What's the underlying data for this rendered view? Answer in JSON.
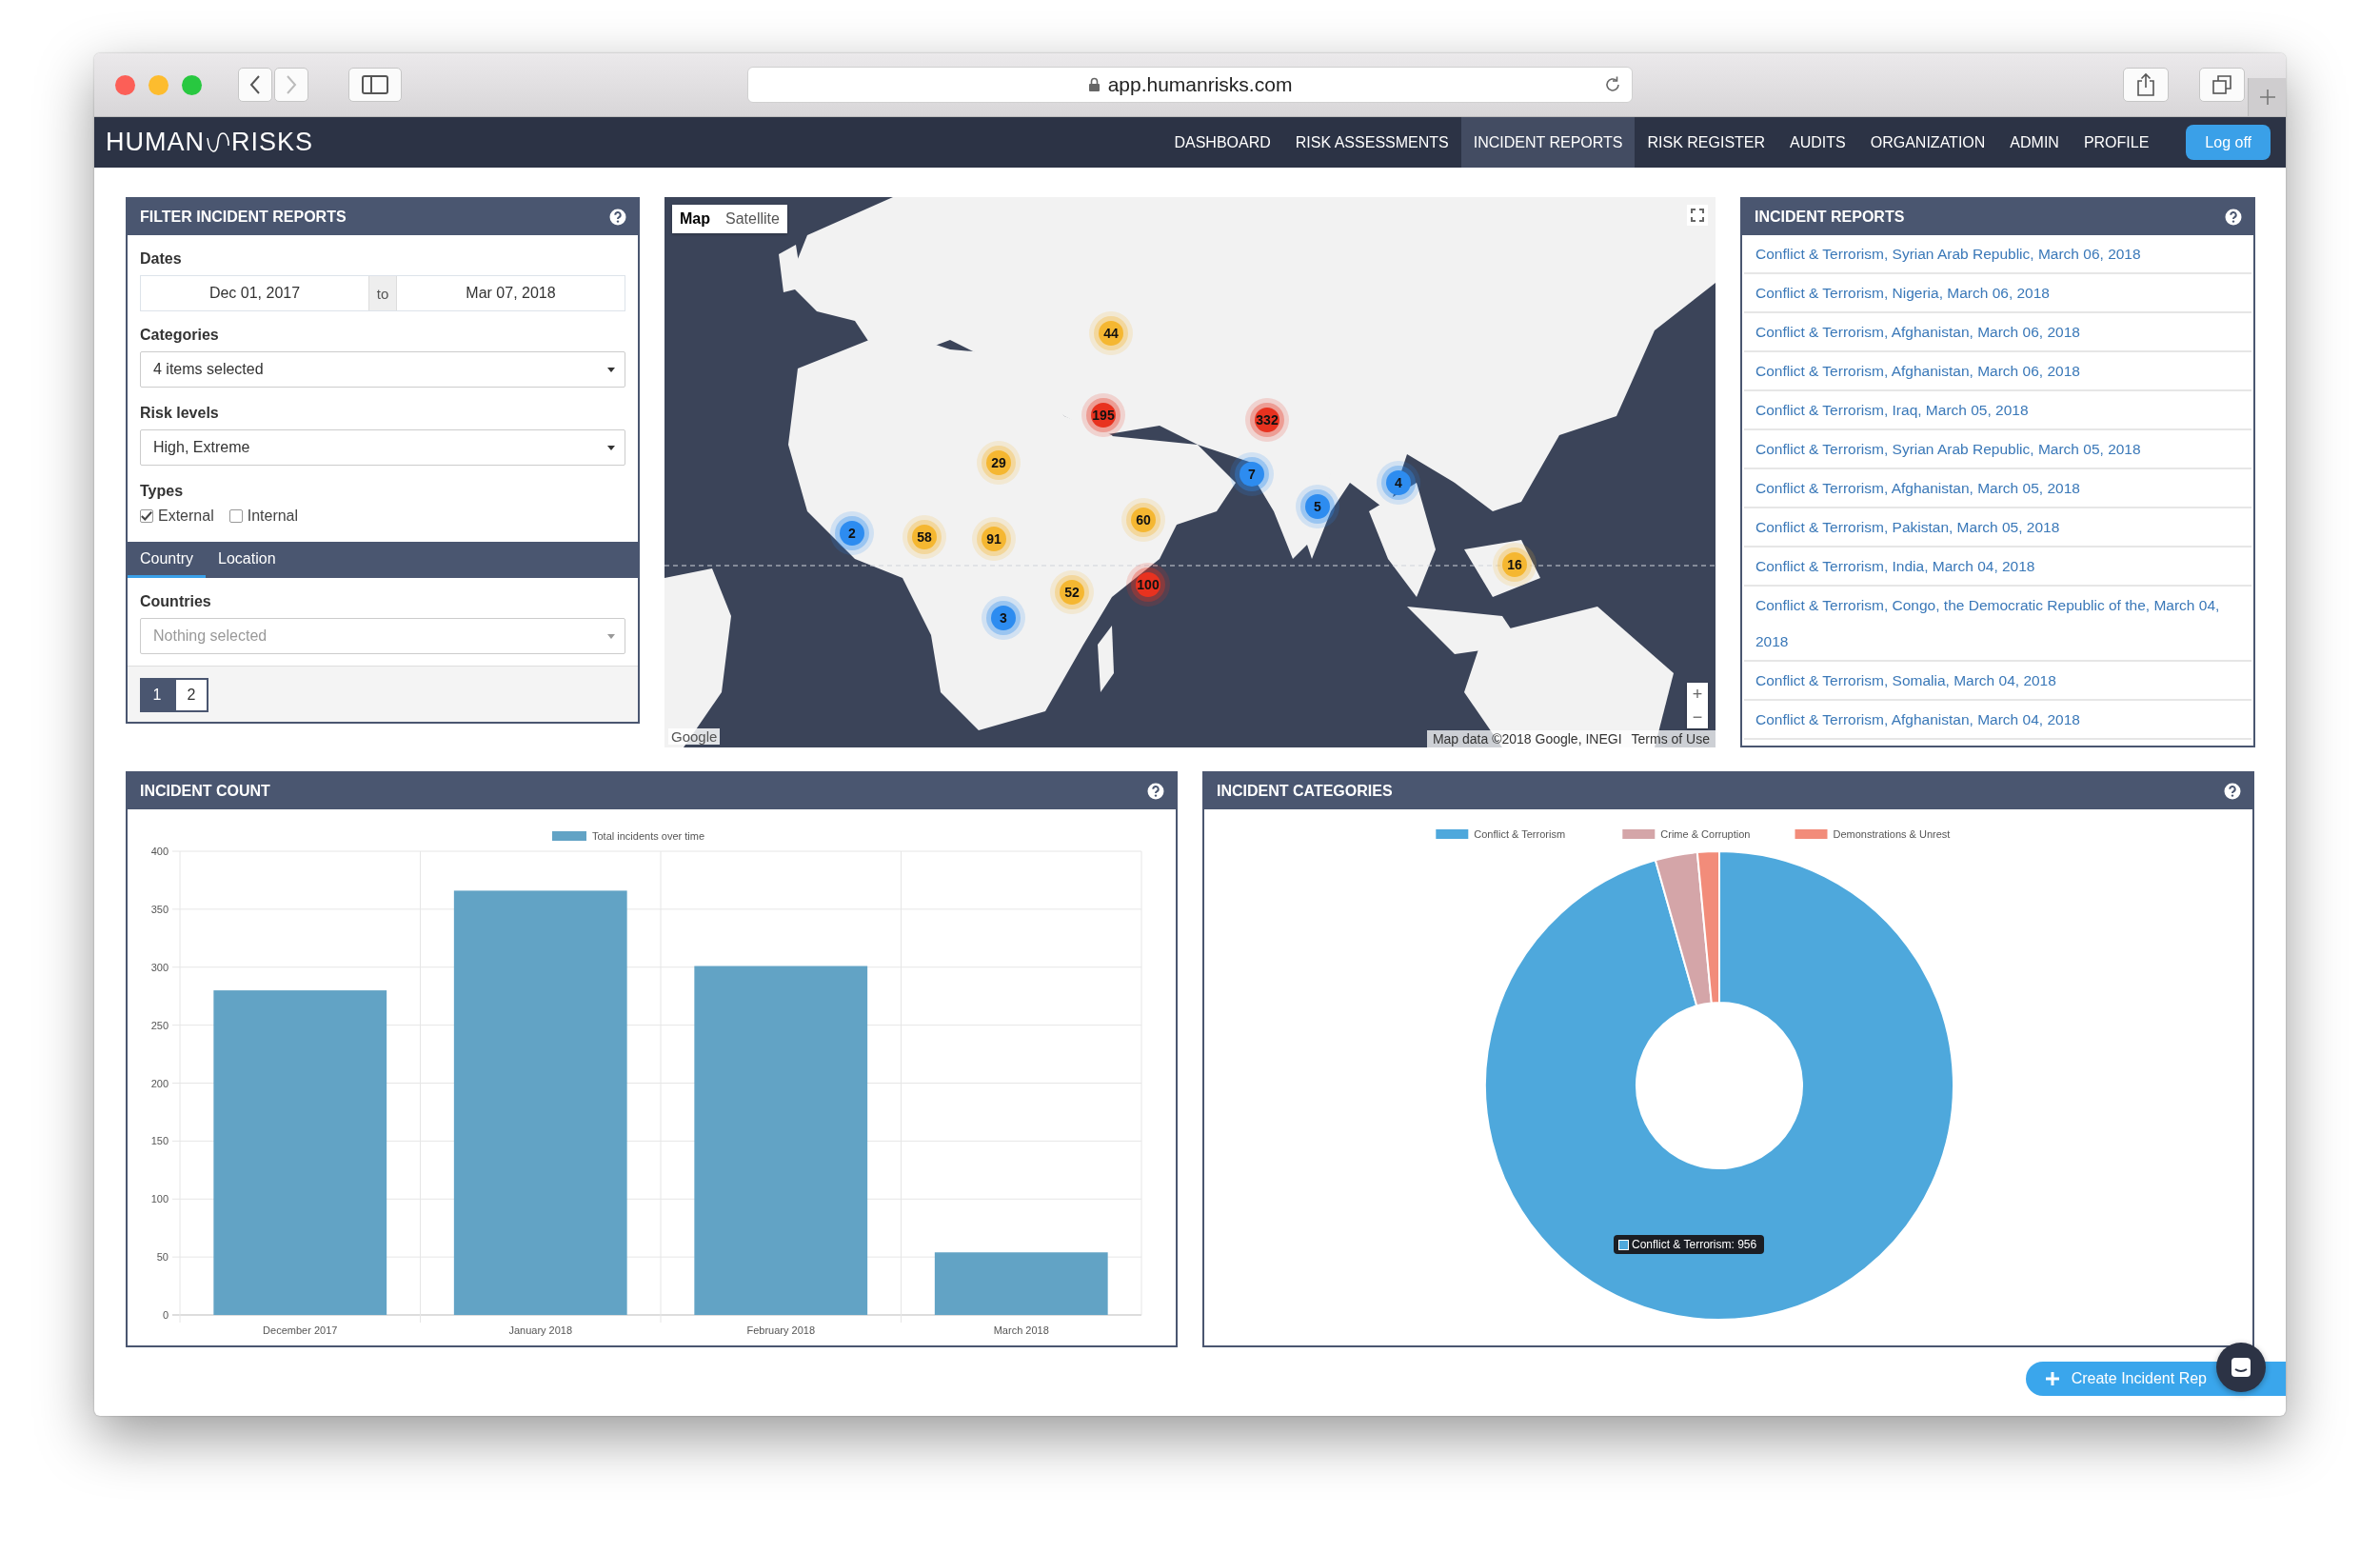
{
  "browser": {
    "url": "app.humanrisks.com"
  },
  "logo": [
    "HUMAN",
    "RISKS"
  ],
  "nav": [
    {
      "label": "DASHBOARD",
      "selected": false
    },
    {
      "label": "RISK ASSESSMENTS",
      "selected": false
    },
    {
      "label": "INCIDENT REPORTS",
      "selected": true
    },
    {
      "label": "RISK REGISTER",
      "selected": false
    },
    {
      "label": "AUDITS",
      "selected": false
    },
    {
      "label": "ORGANIZATION",
      "selected": false
    },
    {
      "label": "ADMIN",
      "selected": false
    },
    {
      "label": "PROFILE",
      "selected": false
    }
  ],
  "logoff": "Log off",
  "filter": {
    "title": "FILTER INCIDENT REPORTS",
    "dates_label": "Dates",
    "date_from": "Dec 01, 2017",
    "date_sep": "to",
    "date_to": "Mar 07, 2018",
    "categories_label": "Categories",
    "categories_value": "4 items selected",
    "risk_label": "Risk levels",
    "risk_value": "High, Extreme",
    "types_label": "Types",
    "types": [
      {
        "label": "External",
        "checked": true
      },
      {
        "label": "Internal",
        "checked": false
      }
    ],
    "tabs": [
      {
        "label": "Country",
        "selected": true
      },
      {
        "label": "Location",
        "selected": false
      }
    ],
    "countries_label": "Countries",
    "countries_placeholder": "Nothing selected",
    "pages": [
      {
        "label": "1",
        "selected": true
      },
      {
        "label": "2",
        "selected": false
      }
    ]
  },
  "map": {
    "kind": "picture",
    "modes": [
      {
        "label": "Map",
        "selected": true
      },
      {
        "label": "Satellite",
        "selected": false
      }
    ],
    "markers": [
      {
        "count": "44",
        "color": "#f5b731"
      },
      {
        "count": "195",
        "color": "#e8321f"
      },
      {
        "count": "332",
        "color": "#e8321f"
      },
      {
        "count": "29",
        "color": "#f5b731"
      },
      {
        "count": "7",
        "color": "#2d8cf0"
      },
      {
        "count": "4",
        "color": "#2d8cf0"
      },
      {
        "count": "5",
        "color": "#2d8cf0"
      },
      {
        "count": "2",
        "color": "#2d8cf0"
      },
      {
        "count": "58",
        "color": "#f5b731"
      },
      {
        "count": "91",
        "color": "#f5b731"
      },
      {
        "count": "60",
        "color": "#f5b731"
      },
      {
        "count": "16",
        "color": "#f5b731"
      },
      {
        "count": "52",
        "color": "#f5b731"
      },
      {
        "count": "100",
        "color": "#e8321f"
      },
      {
        "count": "3",
        "color": "#2d8cf0"
      }
    ],
    "zoom_in": "+",
    "zoom_out": "−",
    "brand": "Google",
    "attribution": "Map data ©2018 Google, INEGI",
    "terms": "Terms of Use"
  },
  "reports": {
    "title": "INCIDENT REPORTS",
    "items": [
      "Conflict & Terrorism, Syrian Arab Republic, March 06, 2018",
      "Conflict & Terrorism, Nigeria, March 06, 2018",
      "Conflict & Terrorism, Afghanistan, March 06, 2018",
      "Conflict & Terrorism, Afghanistan, March 06, 2018",
      "Conflict & Terrorism, Iraq, March 05, 2018",
      "Conflict & Terrorism, Syrian Arab Republic, March 05, 2018",
      "Conflict & Terrorism, Afghanistan, March 05, 2018",
      "Conflict & Terrorism, Pakistan, March 05, 2018",
      "Conflict & Terrorism, India, March 04, 2018",
      "Conflict & Terrorism, Congo, the Democratic Republic of the, March 04, 2018",
      "Conflict & Terrorism, Somalia, March 04, 2018",
      "Conflict & Terrorism, Afghanistan, March 04, 2018"
    ]
  },
  "incident_count": {
    "title": "INCIDENT COUNT",
    "chart_data": {
      "type": "bar",
      "categories": [
        "December 2017",
        "January 2018",
        "February 2018",
        "March 2018"
      ],
      "series": [
        {
          "name": "Total incidents over time",
          "color": "#62a3c5",
          "values": [
            280,
            366,
            301,
            54
          ]
        }
      ],
      "ylim": [
        0,
        400
      ],
      "yticks": [
        0,
        50,
        100,
        150,
        200,
        250,
        300,
        350,
        400
      ],
      "grid": true,
      "legend": "top"
    }
  },
  "incident_categories": {
    "title": "INCIDENT CATEGORIES",
    "chart_data": {
      "type": "donut",
      "categories": [
        "Conflict & Terrorism",
        "Crime & Corruption",
        "Demonstrations & Unrest"
      ],
      "values": [
        95.6,
        2.9,
        1.5
      ],
      "colors": [
        "#4ea8dc",
        "#d4a5a8",
        "#f28c7a"
      ],
      "legend": "top"
    },
    "tooltip": "Conflict & Terrorism: 956"
  },
  "create_button": "Create Incident Rep"
}
